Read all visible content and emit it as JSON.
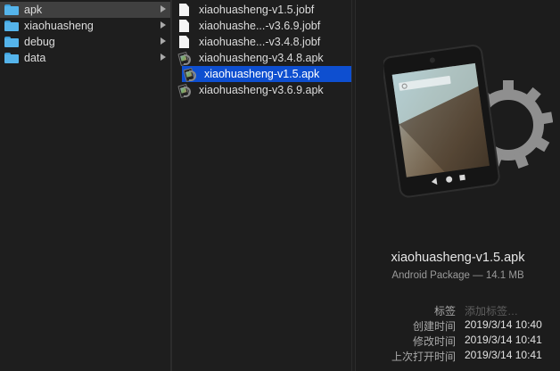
{
  "folders": [
    {
      "name": "apk",
      "selected": true
    },
    {
      "name": "xiaohuasheng",
      "selected": false
    },
    {
      "name": "debug",
      "selected": false
    },
    {
      "name": "data",
      "selected": false
    }
  ],
  "files": [
    {
      "name": "xiaohuasheng-v1.5.jobf",
      "icon": "document-icon"
    },
    {
      "name": "xiaohuashe...-v3.6.9.jobf",
      "icon": "document-icon"
    },
    {
      "name": "xiaohuashe...-v3.4.8.jobf",
      "icon": "document-icon"
    },
    {
      "name": "xiaohuasheng-v3.4.8.apk",
      "icon": "apk-file-icon"
    },
    {
      "name": "xiaohuasheng-v1.5.apk",
      "icon": "apk-file-icon",
      "selected": true
    },
    {
      "name": "xiaohuasheng-v3.6.9.apk",
      "icon": "apk-file-icon"
    }
  ],
  "preview": {
    "icon": "android-package-icon",
    "filename": "xiaohuasheng-v1.5.apk",
    "kind": "Android Package — 14.1 MB",
    "tags_label": "标签",
    "tags_placeholder": "添加标签…",
    "created_label": "创建时间",
    "created_value": "2019/3/14 10:40",
    "modified_label": "修改时间",
    "modified_value": "2019/3/14 10:41",
    "opened_label": "上次打开时间",
    "opened_value": "2019/3/14 10:41"
  },
  "colors": {
    "selection": "#0e4fd0",
    "folder": "#55b4eb",
    "background": "#1e1e1e"
  }
}
